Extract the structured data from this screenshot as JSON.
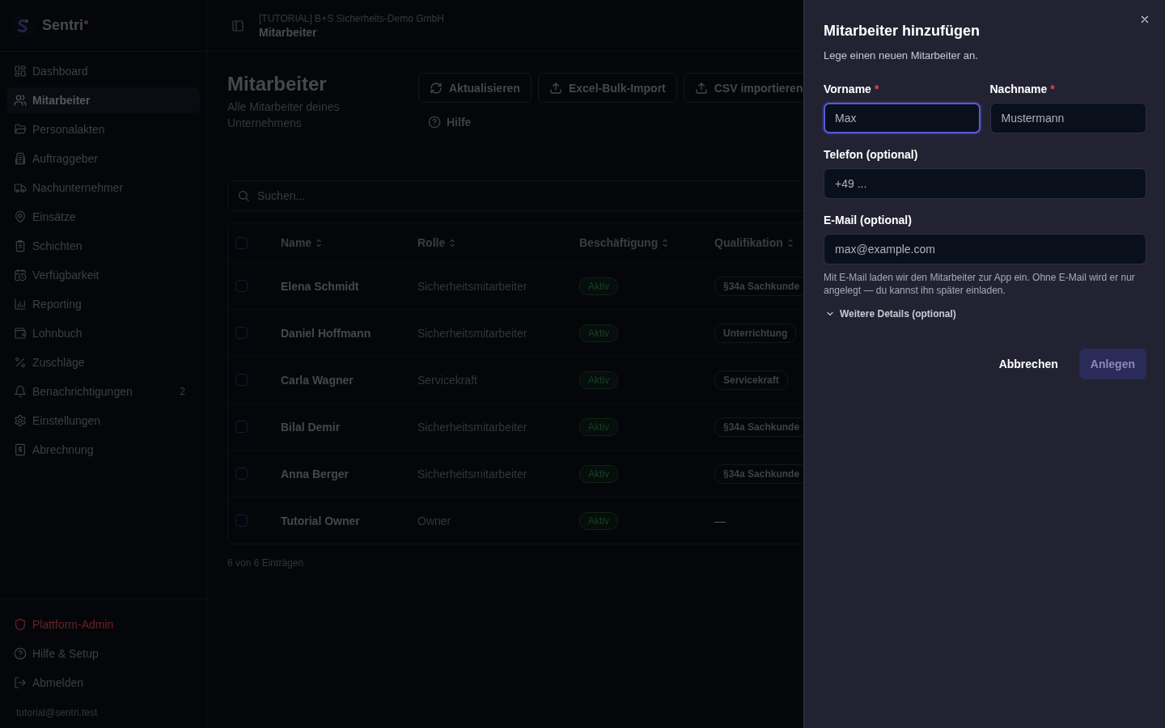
{
  "sidebar": {
    "brand": "Sentri",
    "items": [
      {
        "label": "Dashboard",
        "selected": false
      },
      {
        "label": "Mitarbeiter",
        "selected": true
      },
      {
        "label": "Personalakten",
        "selected": false
      },
      {
        "label": "Auftraggeber",
        "selected": false
      },
      {
        "label": "Nachunternehmer",
        "selected": false
      },
      {
        "label": "Einsätze",
        "selected": false
      },
      {
        "label": "Schichten",
        "selected": false
      },
      {
        "label": "Verfügbarkeit",
        "selected": false
      },
      {
        "label": "Reporting",
        "selected": false
      },
      {
        "label": "Lohnbuch",
        "selected": false
      },
      {
        "label": "Zuschläge",
        "selected": false
      },
      {
        "label": "Benachrichtigungen",
        "selected": false,
        "badge": "2"
      },
      {
        "label": "Einstellungen",
        "selected": false
      },
      {
        "label": "Abrechnung",
        "selected": false
      }
    ],
    "footer_items": [
      {
        "label": "Plattform-Admin",
        "kind": "danger"
      },
      {
        "label": "Hilfe & Setup",
        "kind": "normal"
      },
      {
        "label": "Abmelden",
        "kind": "normal"
      }
    ],
    "user_email": "tutorial@sentri.test"
  },
  "header": {
    "organization": "[TUTORIAL] B+S Sicherheits-Demo GmbH",
    "page": "Mitarbeiter"
  },
  "page": {
    "title": "Mitarbeiter",
    "subtitle": "Alle Mitarbeiter deines Unternehmens",
    "actions": [
      "Aktualisieren",
      "Excel-Bulk-Import",
      "CSV importieren"
    ],
    "help": "Hilfe"
  },
  "search": {
    "placeholder": "Suchen..."
  },
  "table": {
    "all_checked": false,
    "columns": [
      "Name",
      "Rolle",
      "Beschäftigung",
      "Qualifikation"
    ],
    "rows": [
      {
        "checked": false,
        "name": "Elena Schmidt",
        "role": "Sicherheitsmitarbeiter",
        "status": {
          "kind": "active",
          "text": "Aktiv"
        },
        "qualification": {
          "kind": "badge",
          "text": "§34a Sachkunde"
        }
      },
      {
        "checked": false,
        "name": "Daniel Hoffmann",
        "role": "Sicherheitsmitarbeiter",
        "status": {
          "kind": "active",
          "text": "Aktiv"
        },
        "qualification": {
          "kind": "badge",
          "text": "Unterrichtung"
        }
      },
      {
        "checked": false,
        "name": "Carla Wagner",
        "role": "Servicekraft",
        "status": {
          "kind": "active",
          "text": "Aktiv"
        },
        "qualification": {
          "kind": "badge",
          "text": "Servicekraft"
        }
      },
      {
        "checked": false,
        "name": "Bilal Demir",
        "role": "Sicherheitsmitarbeiter",
        "status": {
          "kind": "active",
          "text": "Aktiv"
        },
        "qualification": {
          "kind": "badge",
          "text": "§34a Sachkunde"
        }
      },
      {
        "checked": false,
        "name": "Anna Berger",
        "role": "Sicherheitsmitarbeiter",
        "status": {
          "kind": "active",
          "text": "Aktiv"
        },
        "qualification": {
          "kind": "badge",
          "text": "§34a Sachkunde"
        }
      },
      {
        "checked": false,
        "name": "Tutorial Owner",
        "role": "Owner",
        "status": {
          "kind": "active",
          "text": "Aktiv"
        },
        "qualification": {
          "kind": "none",
          "text": "—"
        }
      }
    ],
    "footer": "6 von 6 Einträgen"
  },
  "dialog": {
    "title": "Mitarbeiter hinzufügen",
    "description": "Lege einen neuen Mitarbeiter an.",
    "name_fields": [
      {
        "label": "Vorname",
        "required_mark": "*",
        "placeholder": "Max",
        "focused": true
      },
      {
        "label": "Nachname",
        "required_mark": "*",
        "placeholder": "Mustermann",
        "focused": false
      }
    ],
    "contact_fields": [
      {
        "label": "Telefon (optional)",
        "placeholder": "+49 ...",
        "focused": false
      },
      {
        "label": "E-Mail (optional)",
        "placeholder": "max@example.com",
        "focused": false,
        "hint": "Mit E-Mail laden wir den Mitarbeiter zur App ein. Ohne E-Mail wird er nur angelegt — du kannst ihn später einladen."
      }
    ],
    "more": {
      "label": "Weitere Details (optional)",
      "expanded": false
    },
    "cancel": "Abbrechen",
    "submit": {
      "label": "Anlegen",
      "disabled": true
    }
  }
}
